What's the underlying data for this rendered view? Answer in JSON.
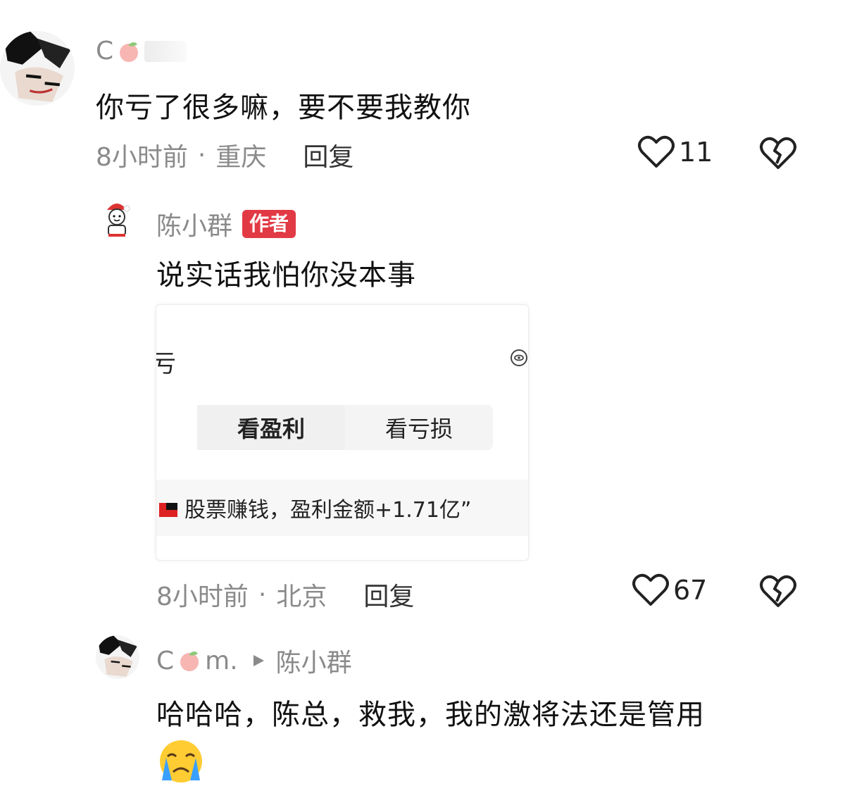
{
  "comment1": {
    "username": "C",
    "text": "你亏了很多嘛，要不要我教你",
    "time": "8小时前",
    "location": "重庆",
    "reply_label": "回复",
    "likes": "11"
  },
  "reply1": {
    "username": "陈小群",
    "badge": "作者",
    "text": "说实话我怕你没本事",
    "card": {
      "corner_char": "亏",
      "tab_profit": "看盈利",
      "tab_loss": "看亏损",
      "footer_text": "股票赚钱，盈利金额+1.71亿”"
    },
    "time": "8小时前",
    "location": "北京",
    "reply_label": "回复",
    "likes": "67"
  },
  "reply2": {
    "username_prefix": "C",
    "username_suffix": "m.",
    "reply_to": "陈小群",
    "text": "哈哈哈，陈总，救我，我的激将法还是管用"
  },
  "colors": {
    "badge": "#e23a45",
    "meta": "#8a8a8a",
    "text": "#111111"
  },
  "icons": {
    "like": "heart-outline-icon",
    "dislike": "broken-heart-icon",
    "emoji": "crying-face-emoji-icon",
    "peach": "peach-emoji-icon",
    "arrow": "play-triangle-icon"
  }
}
